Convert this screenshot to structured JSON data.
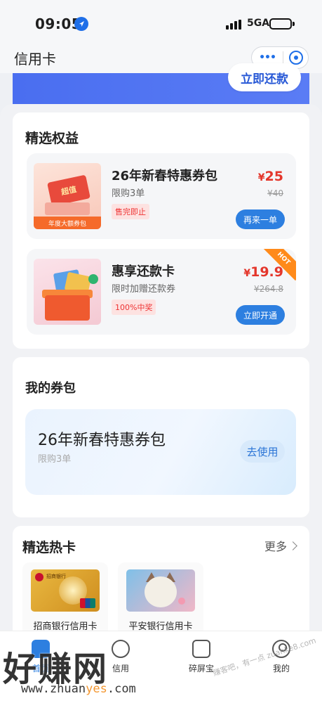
{
  "status": {
    "time": "09:05",
    "network": "5GA"
  },
  "nav": {
    "title": "信用卡",
    "more_label": "•••"
  },
  "banner": {
    "repay_label": "立即还款"
  },
  "benefits": {
    "title": "精选权益",
    "items": [
      {
        "name": "26年新春特惠券包",
        "sub": "限购3单",
        "tag": "售完即止",
        "price_symbol": "¥",
        "price": "25",
        "original": "¥40",
        "button": "再来一单",
        "thumb_badge": "超值",
        "thumb_caption": "年度大额券包"
      },
      {
        "name": "惠享还款卡",
        "sub": "限时加赠还款券",
        "tag": "100%中奖",
        "price_symbol": "¥",
        "price": "19.9",
        "original": "¥264.8",
        "button": "立即开通",
        "badge": "HOT"
      }
    ]
  },
  "wallet": {
    "title": "我的券包",
    "coupon_title": "26年新春特惠券包",
    "coupon_sub": "限购3单",
    "use_label": "去使用"
  },
  "hot_cards": {
    "title": "精选热卡",
    "more_label": "更多",
    "items": [
      {
        "label": "招商银行信用卡",
        "img_text": "招商银行"
      },
      {
        "label": "平安银行信用卡"
      }
    ]
  },
  "tabs": [
    {
      "label": "首页"
    },
    {
      "label": "信用"
    },
    {
      "label": "碎屏宝"
    },
    {
      "label": "我的"
    }
  ],
  "watermark": {
    "brand": "好赚网",
    "url_prefix": "www.zhuan",
    "url_highlight": "yes",
    "url_suffix": ".com",
    "side": "赚客吧，有一点 zuanke8.com"
  },
  "colors": {
    "accent": "#2d7fe0",
    "price_red": "#e4362b",
    "hot_orange": "#ff8a1a"
  }
}
